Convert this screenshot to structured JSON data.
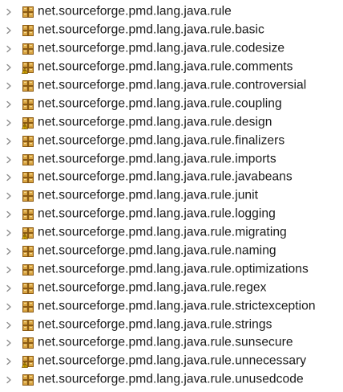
{
  "tree": {
    "items": [
      {
        "label": "net.sourceforge.pmd.lang.java.rule",
        "icon": "package-icon"
      },
      {
        "label": "net.sourceforge.pmd.lang.java.rule.basic",
        "icon": "package-icon"
      },
      {
        "label": "net.sourceforge.pmd.lang.java.rule.codesize",
        "icon": "package-icon"
      },
      {
        "label": "net.sourceforge.pmd.lang.java.rule.comments",
        "icon": "package-warning-icon"
      },
      {
        "label": "net.sourceforge.pmd.lang.java.rule.controversial",
        "icon": "package-icon"
      },
      {
        "label": "net.sourceforge.pmd.lang.java.rule.coupling",
        "icon": "package-icon"
      },
      {
        "label": "net.sourceforge.pmd.lang.java.rule.design",
        "icon": "package-warning-icon"
      },
      {
        "label": "net.sourceforge.pmd.lang.java.rule.finalizers",
        "icon": "package-icon"
      },
      {
        "label": "net.sourceforge.pmd.lang.java.rule.imports",
        "icon": "package-icon"
      },
      {
        "label": "net.sourceforge.pmd.lang.java.rule.javabeans",
        "icon": "package-icon"
      },
      {
        "label": "net.sourceforge.pmd.lang.java.rule.junit",
        "icon": "package-icon"
      },
      {
        "label": "net.sourceforge.pmd.lang.java.rule.logging",
        "icon": "package-icon"
      },
      {
        "label": "net.sourceforge.pmd.lang.java.rule.migrating",
        "icon": "package-warning-icon"
      },
      {
        "label": "net.sourceforge.pmd.lang.java.rule.naming",
        "icon": "package-icon"
      },
      {
        "label": "net.sourceforge.pmd.lang.java.rule.optimizations",
        "icon": "package-icon"
      },
      {
        "label": "net.sourceforge.pmd.lang.java.rule.regex",
        "icon": "package-icon"
      },
      {
        "label": "net.sourceforge.pmd.lang.java.rule.strictexception",
        "icon": "package-icon"
      },
      {
        "label": "net.sourceforge.pmd.lang.java.rule.strings",
        "icon": "package-icon"
      },
      {
        "label": "net.sourceforge.pmd.lang.java.rule.sunsecure",
        "icon": "package-icon"
      },
      {
        "label": "net.sourceforge.pmd.lang.java.rule.unnecessary",
        "icon": "package-warning-icon"
      },
      {
        "label": "net.sourceforge.pmd.lang.java.rule.unusedcode",
        "icon": "package-icon"
      }
    ]
  },
  "colors": {
    "text": "#1a1a1a",
    "chevron": "#8a8a8a",
    "package_fill": "#d9a441",
    "package_dark": "#8a5a14",
    "warning": "#e6b400"
  }
}
